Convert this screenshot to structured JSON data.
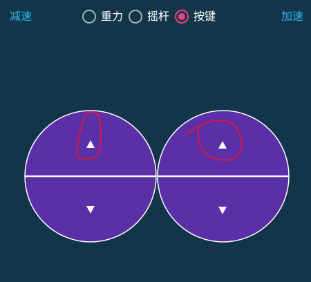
{
  "toolbar": {
    "decelerate_label": "减速",
    "accelerate_label": "加速"
  },
  "modes": [
    {
      "label": "重力",
      "selected": false
    },
    {
      "label": "摇杆",
      "selected": false
    },
    {
      "label": "按键",
      "selected": true
    }
  ],
  "colors": {
    "background": "#133549",
    "accent": "#2cb5e8",
    "radio_selected": "#f0447f",
    "radio_unselected": "#9fb3c2",
    "pad_fill": "#5b2fa8",
    "annotation": "#c41c54"
  },
  "controls": {
    "left_pad": {
      "up_icon": "triangle-up-icon",
      "down_icon": "triangle-down-icon"
    },
    "right_pad": {
      "up_icon": "triangle-up-icon",
      "down_icon": "triangle-down-icon"
    }
  }
}
